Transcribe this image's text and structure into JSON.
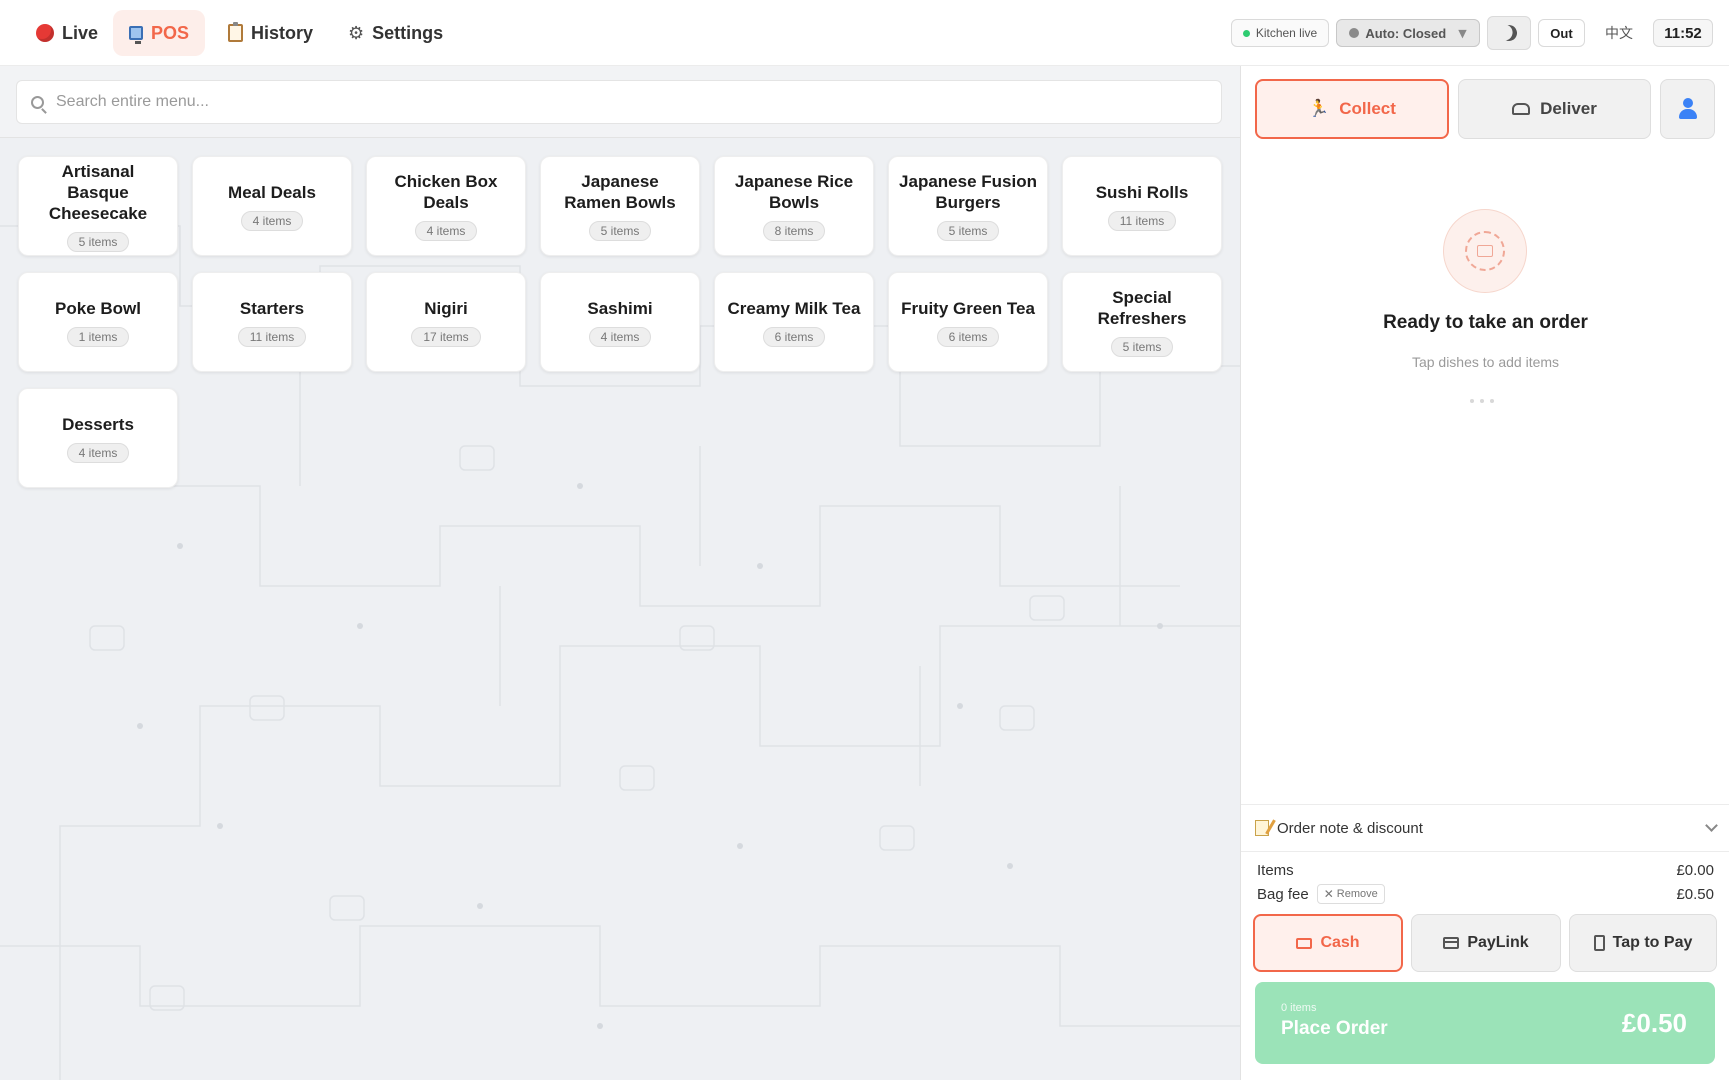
{
  "nav": {
    "tabs": [
      {
        "label": "Live",
        "icon": "live-dot-icon"
      },
      {
        "label": "POS",
        "icon": "monitor-icon"
      },
      {
        "label": "History",
        "icon": "clipboard-icon"
      },
      {
        "label": "Settings",
        "icon": "gear-icon"
      }
    ],
    "active_tab": "POS",
    "kitchen_status": "Kitchen live",
    "auto_mode": "Auto: Closed",
    "out_label": "Out",
    "language": "中文",
    "clock": "11:52"
  },
  "search": {
    "placeholder": "Search entire menu...",
    "value": ""
  },
  "categories": [
    {
      "name": "Artisanal Basque Cheesecake",
      "count": "5 items"
    },
    {
      "name": "Meal Deals",
      "count": "4 items"
    },
    {
      "name": "Chicken Box Deals",
      "count": "4 items"
    },
    {
      "name": "Japanese Ramen Bowls",
      "count": "5 items"
    },
    {
      "name": "Japanese Rice Bowls",
      "count": "8 items"
    },
    {
      "name": "Japanese Fusion Burgers",
      "count": "5 items"
    },
    {
      "name": "Sushi Rolls",
      "count": "11 items"
    },
    {
      "name": "Poke Bowl",
      "count": "1 items"
    },
    {
      "name": "Starters",
      "count": "11 items"
    },
    {
      "name": "Nigiri",
      "count": "17 items"
    },
    {
      "name": "Sashimi",
      "count": "4 items"
    },
    {
      "name": "Creamy Milk Tea",
      "count": "6 items"
    },
    {
      "name": "Fruity Green Tea",
      "count": "6 items"
    },
    {
      "name": "Special Refreshers",
      "count": "5 items"
    },
    {
      "name": "Desserts",
      "count": "4 items"
    }
  ],
  "order": {
    "modes": [
      {
        "label": "Collect",
        "icon": "running-person-icon",
        "active": true
      },
      {
        "label": "Deliver",
        "icon": "scooter-icon",
        "active": false
      }
    ],
    "empty_title": "Ready to take an order",
    "empty_subtitle": "Tap dishes to add items",
    "note_label": "Order note & discount",
    "items_label": "Items",
    "items_amount": "£0.00",
    "bag_fee_label": "Bag fee",
    "remove_label": "Remove",
    "bag_fee_amount": "£0.50",
    "payment_methods": [
      {
        "label": "Cash",
        "icon": "cash-icon",
        "active": true
      },
      {
        "label": "PayLink",
        "icon": "card-icon",
        "active": false
      },
      {
        "label": "Tap to Pay",
        "icon": "phone-icon",
        "active": false
      }
    ],
    "place_order": {
      "count": "0 items",
      "label": "Place Order",
      "total": "£0.50"
    }
  },
  "colors": {
    "accent": "#f2674a",
    "accent_bg": "#fff0ec",
    "place_order_bg": "#9be3b8",
    "live_red": "#e53935",
    "menu_bg": "#eef0f3"
  }
}
